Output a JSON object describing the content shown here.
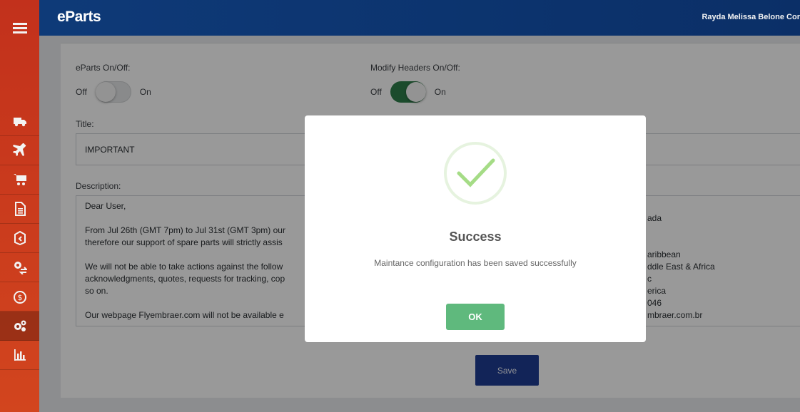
{
  "app": {
    "brand": "eParts",
    "user_name": "Rayda Melissa Belone Cor"
  },
  "sidebar": {
    "menu_icon": "hamburger-menu-icon",
    "items": [
      {
        "icon": "truck-icon"
      },
      {
        "icon": "airplane-icon"
      },
      {
        "icon": "cart-icon"
      },
      {
        "icon": "document-icon"
      },
      {
        "icon": "box-return-icon"
      },
      {
        "icon": "gear-exchange-icon"
      },
      {
        "icon": "dollar-icon"
      },
      {
        "icon": "gears-icon",
        "active": true
      },
      {
        "icon": "bar-chart-icon"
      }
    ]
  },
  "form": {
    "eparts_toggle": {
      "label": "eParts On/Off:",
      "off": "Off",
      "on": "On",
      "state": "off"
    },
    "headers_toggle": {
      "label": "Modify Headers On/Off:",
      "off": "Off",
      "on": "On",
      "state": "on"
    },
    "title_label": "Title:",
    "title_value": "IMPORTANT",
    "description_label": "Description:",
    "description_value": "Dear User,\n\nFrom Jul 26th (GMT 7pm) to Jul 31st (GMT 3pm) our\ntherefore our support of spare parts will strictly assis\n\nWe will not be able to take actions against the follow\nacknowledgments, quotes, requests for tracking, cop\nso on.\n\nOur webpage Flyembraer.com will not be available e",
    "right_text": "ada\n\n\naribbean\nddle East & Africa\nc\nerica\n046\nmbraer.com.br",
    "save_label": "Save"
  },
  "modal": {
    "title": "Success",
    "message": "Maintance configuration has been saved successfully",
    "ok_label": "OK",
    "icon": "success-check-icon",
    "accent": "#5fb97d"
  }
}
